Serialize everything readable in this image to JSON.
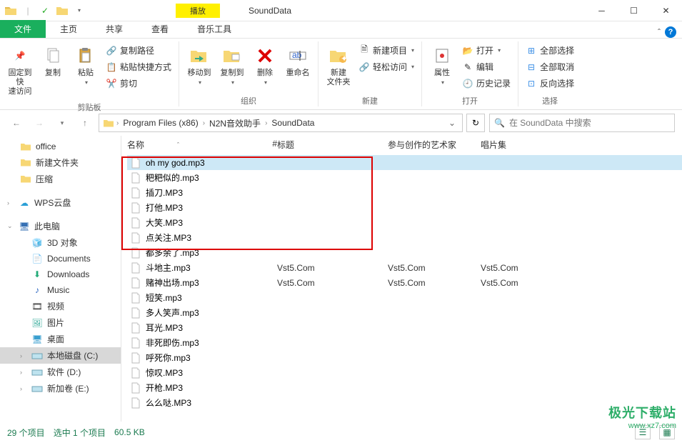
{
  "titlebar": {
    "play_label": "播放",
    "window_title": "SoundData"
  },
  "tabs": {
    "file": "文件",
    "home": "主页",
    "share": "共享",
    "view": "查看",
    "music_tools": "音乐工具"
  },
  "ribbon": {
    "clipboard": {
      "pin": "固定到快\n速访问",
      "copy": "复制",
      "paste": "粘贴",
      "copy_path": "复制路径",
      "paste_shortcut": "粘贴快捷方式",
      "cut": "剪切",
      "group": "剪贴板"
    },
    "organize": {
      "move_to": "移动到",
      "copy_to": "复制到",
      "delete": "删除",
      "rename": "重命名",
      "group": "组织"
    },
    "new": {
      "new_folder": "新建\n文件夹",
      "new_item": "新建项目",
      "easy_access": "轻松访问",
      "group": "新建"
    },
    "open": {
      "properties": "属性",
      "open": "打开",
      "edit": "编辑",
      "history": "历史记录",
      "group": "打开"
    },
    "select": {
      "select_all": "全部选择",
      "select_none": "全部取消",
      "invert": "反向选择",
      "group": "选择"
    }
  },
  "breadcrumb": {
    "seg1": "Program Files (x86)",
    "seg2": "N2N音效助手",
    "seg3": "SoundData"
  },
  "search": {
    "placeholder": "在 SoundData 中搜索"
  },
  "nav": {
    "office": "office",
    "new_folder": "新建文件夹",
    "compressed": "压缩",
    "wps": "WPS云盘",
    "this_pc": "此电脑",
    "obj3d": "3D 对象",
    "documents": "Documents",
    "downloads": "Downloads",
    "music": "Music",
    "videos": "视频",
    "pictures": "图片",
    "desktop": "桌面",
    "local_c": "本地磁盘 (C:)",
    "soft_d": "软件 (D:)",
    "vol_e": "新加卷 (E:)"
  },
  "columns": {
    "name": "名称",
    "num": "#",
    "title": "标题",
    "artists": "参与创作的艺术家",
    "album": "唱片集"
  },
  "files": [
    {
      "name": "oh my god.mp3",
      "selected": true,
      "title": "",
      "artists": "",
      "album": ""
    },
    {
      "name": "粑粑似的.mp3",
      "title": "",
      "artists": "",
      "album": ""
    },
    {
      "name": "插刀.MP3",
      "title": "",
      "artists": "",
      "album": ""
    },
    {
      "name": "打他.MP3",
      "title": "",
      "artists": "",
      "album": ""
    },
    {
      "name": "大笑.MP3",
      "title": "",
      "artists": "",
      "album": ""
    },
    {
      "name": "点关注.MP3",
      "title": "",
      "artists": "",
      "album": ""
    },
    {
      "name": "都多余了.mp3",
      "title": "",
      "artists": "",
      "album": ""
    },
    {
      "name": "斗地主.mp3",
      "title": "Vst5.Com",
      "artists": "Vst5.Com",
      "album": "Vst5.Com"
    },
    {
      "name": "赌神出场.mp3",
      "title": "Vst5.Com",
      "artists": "Vst5.Com",
      "album": "Vst5.Com"
    },
    {
      "name": "短笑.mp3",
      "title": "",
      "artists": "",
      "album": ""
    },
    {
      "name": "多人笑声.mp3",
      "title": "",
      "artists": "",
      "album": ""
    },
    {
      "name": "耳光.MP3",
      "title": "",
      "artists": "",
      "album": ""
    },
    {
      "name": "非死即伤.mp3",
      "title": "",
      "artists": "",
      "album": ""
    },
    {
      "name": "呼死你.mp3",
      "title": "",
      "artists": "",
      "album": ""
    },
    {
      "name": "惊叹.MP3",
      "title": "",
      "artists": "",
      "album": ""
    },
    {
      "name": "开枪.MP3",
      "title": "",
      "artists": "",
      "album": ""
    },
    {
      "name": "么么哒.MP3",
      "title": "",
      "artists": "",
      "album": ""
    }
  ],
  "status": {
    "items": "29 个项目",
    "selected": "选中 1 个项目",
    "size": "60.5 KB"
  },
  "watermark": {
    "line1": "极光下载站",
    "line2": "www.xz7.com"
  }
}
